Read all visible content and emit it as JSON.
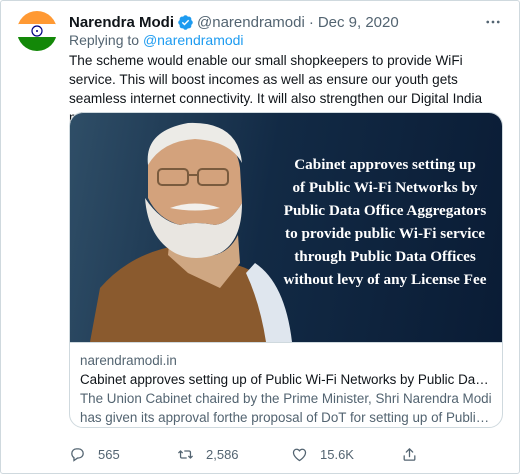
{
  "tweet": {
    "author_name": "Narendra Modi",
    "author_handle": "@narendramodi",
    "separator": "·",
    "date": "Dec 9, 2020",
    "replying_prefix": "Replying to",
    "replying_to": "@narendramodi",
    "text": "The scheme would enable our small shopkeepers to provide WiFi  service. This will boost incomes as well as ensure our youth gets seamless internet connectivity. It will also strengthen our Digital India mission."
  },
  "card": {
    "image_headline": [
      "Cabinet approves setting up",
      "of Public Wi-Fi Networks by",
      "Public Data Office Aggregators",
      "to provide public Wi-Fi service",
      "through Public Data Offices",
      "without levy of any License Fee"
    ],
    "domain": "narendramodi.in",
    "title": "Cabinet approves setting up of Public Wi-Fi Networks by Public Data ...",
    "description_lines": [
      "The Union Cabinet chaired by the Prime Minister, Shri Narendra Modi",
      "has given its approval forthe proposal of DoT for setting up of Public ..."
    ]
  },
  "actions": {
    "reply_count": "565",
    "retweet_count": "2,586",
    "like_count": "15.6K"
  },
  "icons": {
    "verified": "verified-badge-icon",
    "more": "more-options-icon",
    "reply": "reply-icon",
    "retweet": "retweet-icon",
    "like": "like-heart-icon",
    "share": "share-icon"
  },
  "colors": {
    "accent": "#1d9bf0",
    "secondary_text": "#536471",
    "flag_saffron": "#ff9933",
    "flag_green": "#138808",
    "chakra": "#000080"
  }
}
